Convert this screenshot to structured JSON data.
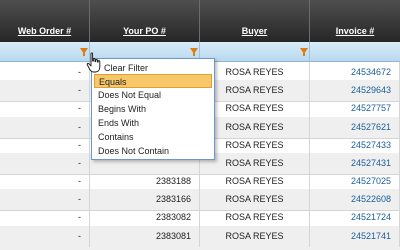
{
  "grid": {
    "columns": [
      {
        "label": "Web Order #"
      },
      {
        "label": "Your PO #"
      },
      {
        "label": "Buyer"
      },
      {
        "label": "Invoice #"
      }
    ],
    "rows": [
      {
        "web_order": "-",
        "po": "",
        "buyer": "ROSA REYES",
        "invoice": "24534672"
      },
      {
        "web_order": "-",
        "po": "",
        "buyer": "ROSA REYES",
        "invoice": "24529643"
      },
      {
        "web_order": "-",
        "po": "",
        "buyer": "ROSA REYES",
        "invoice": "24527757"
      },
      {
        "web_order": "-",
        "po": "",
        "buyer": "ROSA REYES",
        "invoice": "24527621"
      },
      {
        "web_order": "-",
        "po": "",
        "buyer": "ROSA REYES",
        "invoice": "24527433"
      },
      {
        "web_order": "-",
        "po": "",
        "buyer": "ROSA REYES",
        "invoice": "24527431"
      },
      {
        "web_order": "-",
        "po": "2383188",
        "buyer": "ROSA REYES",
        "invoice": "24527025"
      },
      {
        "web_order": "-",
        "po": "2383166",
        "buyer": "ROSA REYES",
        "invoice": "24522608"
      },
      {
        "web_order": "-",
        "po": "2383082",
        "buyer": "ROSA REYES",
        "invoice": "24521724"
      },
      {
        "web_order": "-",
        "po": "2383081",
        "buyer": "ROSA REYES",
        "invoice": "24521741"
      }
    ]
  },
  "filter_menu": {
    "items": [
      {
        "label": "Clear Filter",
        "selected": false
      },
      {
        "label": "Equals",
        "selected": true
      },
      {
        "label": "Does Not Equal",
        "selected": false
      },
      {
        "label": "Begins With",
        "selected": false
      },
      {
        "label": "Ends With",
        "selected": false
      },
      {
        "label": "Contains",
        "selected": false
      },
      {
        "label": "Does Not Contain",
        "selected": false
      }
    ]
  },
  "icons": {
    "filter": "funnel-icon",
    "cursor": "hand-pointer-icon"
  },
  "colors": {
    "header_bg": "#333333",
    "filter_row_bg": "#c6e0f3",
    "link": "#1c5d99",
    "menu_highlight": "#f6c86a",
    "funnel": "#e07b10"
  }
}
